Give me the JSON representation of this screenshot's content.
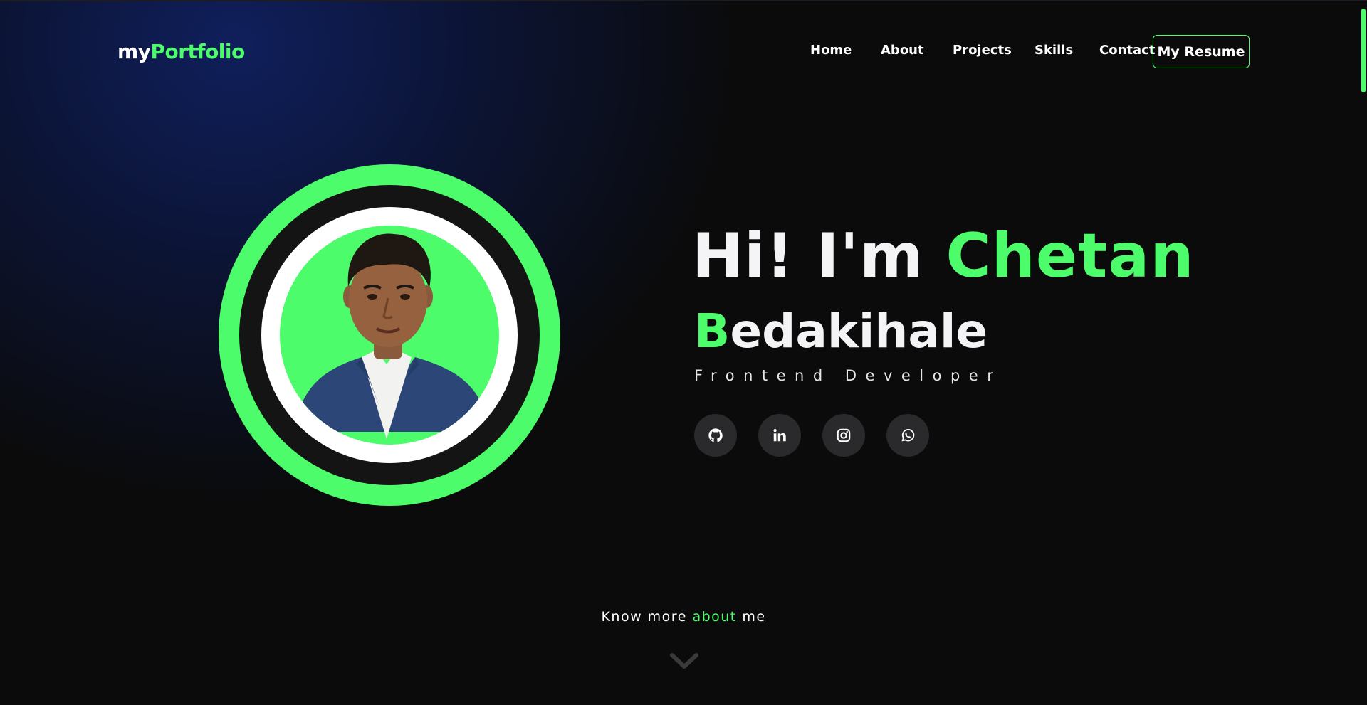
{
  "header": {
    "logo_prefix": "my",
    "logo_highlight": "Portfolio",
    "nav": [
      {
        "label": "Home"
      },
      {
        "label": "About"
      },
      {
        "label": "Projects"
      },
      {
        "label": "Skills"
      },
      {
        "label": "Contact"
      }
    ],
    "resume_label": "My Resume"
  },
  "hero": {
    "greeting_prefix": "Hi! I'm",
    "first_name": "Chetan",
    "last_initial": "B",
    "last_rest": "edakihale",
    "role": "Frontend Developer",
    "social": [
      {
        "icon": "github-icon"
      },
      {
        "icon": "linkedin-icon"
      },
      {
        "icon": "instagram-icon"
      },
      {
        "icon": "whatsapp-icon"
      }
    ]
  },
  "footer": {
    "know_prefix": "Know more",
    "know_highlight": "about",
    "know_suffix": "me",
    "chevron_icon": "chevron-down-icon"
  },
  "colors": {
    "accent": "#4cfc6a",
    "background": "#0b0b0c",
    "glow": "#102060",
    "social_bg": "#2a2a2c"
  }
}
